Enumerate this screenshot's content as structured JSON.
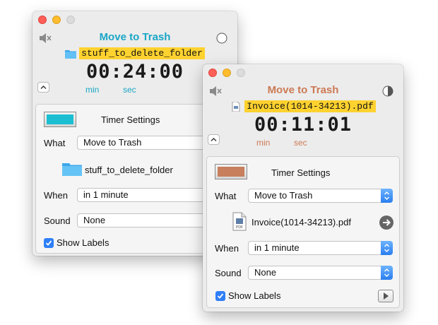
{
  "window1": {
    "title": "Move to Trash",
    "file_name": "stuff_to_delete_folder",
    "time": "00:24:00",
    "min_label": "min",
    "sec_label": "sec",
    "settings_title": "Timer Settings",
    "swatch_color": "#1bbfd1",
    "what_label": "What",
    "what_value": "Move to Trash",
    "target_name": "stuff_to_delete_folder",
    "when_label": "When",
    "when_value": "in 1 minute",
    "sound_label": "Sound",
    "sound_value": "None",
    "show_labels": "Show Labels",
    "show_labels_checked": true
  },
  "window2": {
    "title": "Move to Trash",
    "file_name": "Invoice(1014-34213).pdf",
    "time": "00:11:01",
    "min_label": "min",
    "sec_label": "sec",
    "settings_title": "Timer Settings",
    "swatch_color": "#c77f5d",
    "what_label": "What",
    "what_value": "Move to Trash",
    "target_name": "Invoice(1014-34213).pdf",
    "pdf_label": "PDF",
    "when_label": "When",
    "when_value": "in 1 minute",
    "sound_label": "Sound",
    "sound_value": "None",
    "show_labels": "Show Labels",
    "show_labels_checked": true
  },
  "colors": {
    "accent_blue": "#1aa6c6",
    "accent_orange": "#cc7a55",
    "highlight": "#ffd22f",
    "checkbox": "#2f7ff7"
  },
  "icons": [
    "mute-icon",
    "folder-icon",
    "circle-icon",
    "half-circle-icon",
    "pdf-file-icon",
    "chevron-up-icon",
    "arrow-right-icon",
    "play-icon",
    "stepper-icon",
    "checkmark-icon"
  ]
}
